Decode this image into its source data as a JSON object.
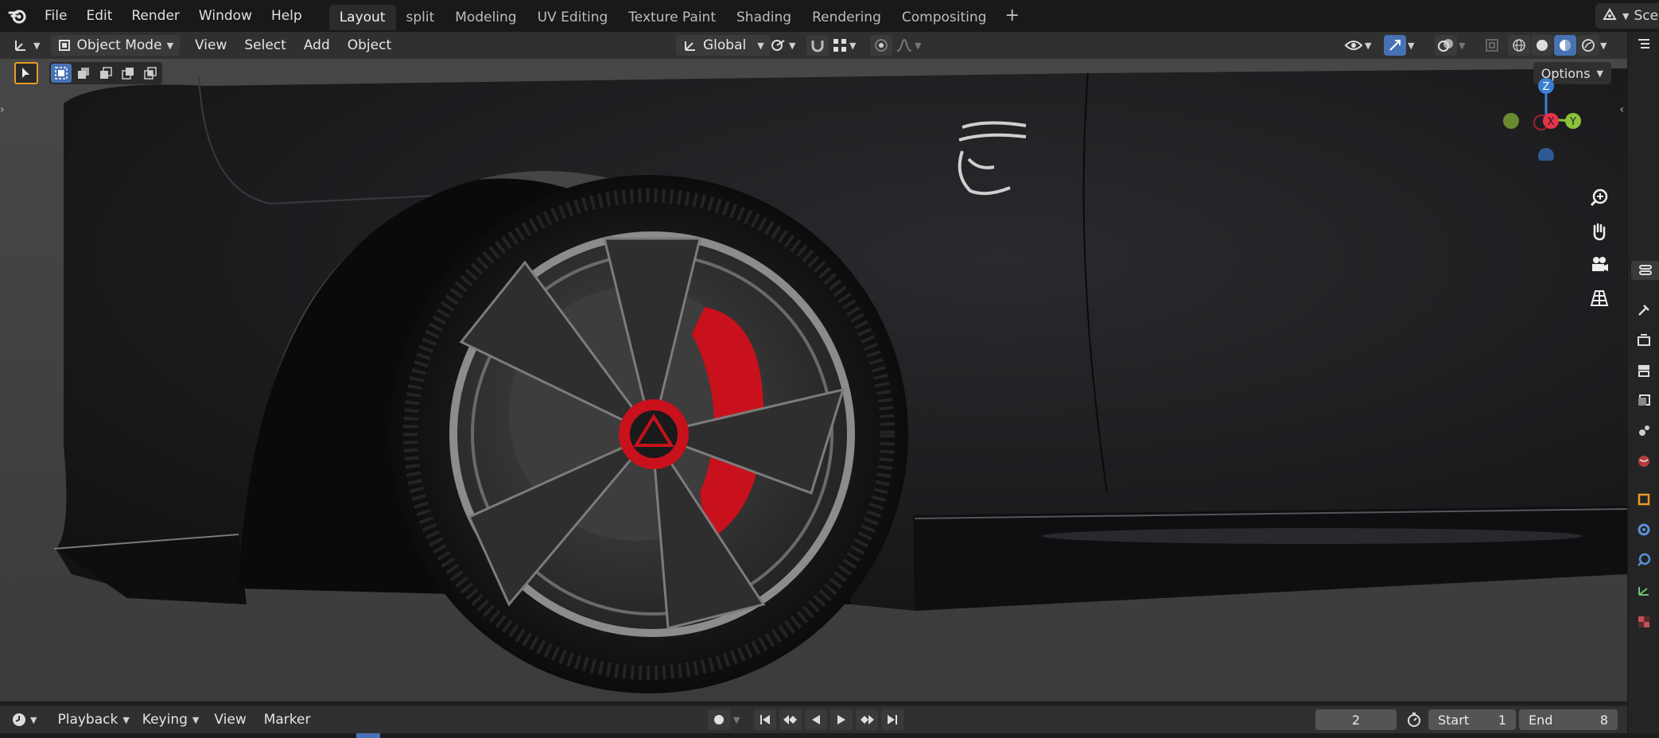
{
  "topbar": {
    "menu": [
      "File",
      "Edit",
      "Render",
      "Window",
      "Help"
    ],
    "workspaces": [
      {
        "label": "Layout",
        "active": true
      },
      {
        "label": "split",
        "active": false
      },
      {
        "label": "Modeling",
        "active": false
      },
      {
        "label": "UV Editing",
        "active": false
      },
      {
        "label": "Texture Paint",
        "active": false
      },
      {
        "label": "Shading",
        "active": false
      },
      {
        "label": "Rendering",
        "active": false
      },
      {
        "label": "Compositing",
        "active": false
      }
    ],
    "scene_label": "Sce"
  },
  "viewport_header": {
    "mode": "Object Mode",
    "menus": [
      "View",
      "Select",
      "Add",
      "Object"
    ],
    "transform_orientation": "Global",
    "options_label": "Options"
  },
  "gizmo": {
    "z": "Z",
    "x": "X",
    "y": "Y"
  },
  "timeline": {
    "menus": [
      "Playback",
      "Keying",
      "View",
      "Marker"
    ],
    "current_frame": "2",
    "start_label": "Start",
    "start_value": "1",
    "end_label": "End",
    "end_value": "8"
  },
  "colors": {
    "accent": "#4772b3",
    "active_tool": "#e89b27",
    "axis_x": "#e8324a",
    "axis_y": "#8cc23a",
    "axis_z": "#3a7fd1",
    "caliper": "#c8111c"
  }
}
